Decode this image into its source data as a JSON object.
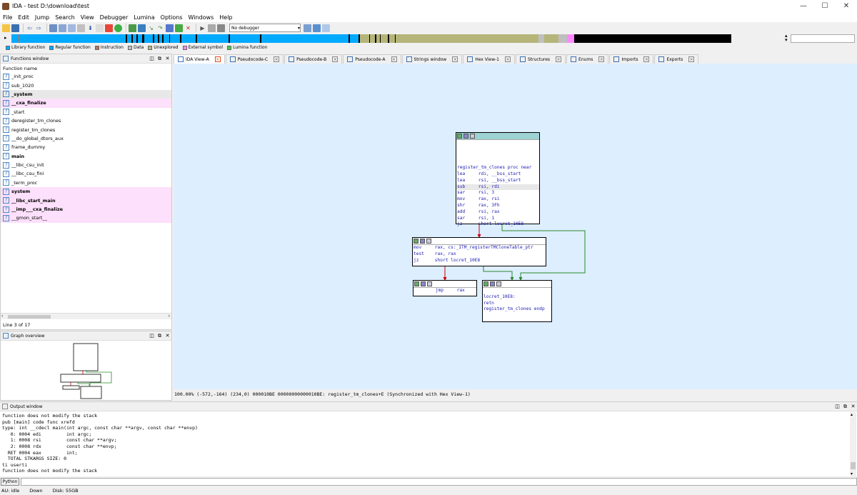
{
  "window": {
    "title": "IDA - test D:\\download\\test",
    "minimize": "—",
    "maximize": "☐",
    "close": "✕"
  },
  "menu": [
    "File",
    "Edit",
    "Jump",
    "Search",
    "View",
    "Debugger",
    "Lumina",
    "Options",
    "Windows",
    "Help"
  ],
  "toolbar": {
    "debugger": "No debugger"
  },
  "legend": [
    {
      "label": "Library function",
      "color": "#00aaff"
    },
    {
      "label": "Regular function",
      "color": "#00aaff"
    },
    {
      "label": "Instruction",
      "color": "#b5725a"
    },
    {
      "label": "Data",
      "color": "#bfbfbf"
    },
    {
      "label": "Unexplored",
      "color": "#b5b57a"
    },
    {
      "label": "External symbol",
      "color": "#ff88ff"
    },
    {
      "label": "Lumina function",
      "color": "#44cc44"
    }
  ],
  "functions_window": {
    "title": "Functions window",
    "column": "Function name",
    "status": "Line 3 of 17",
    "items": [
      {
        "name": "_init_proc",
        "style": ""
      },
      {
        "name": "sub_1020",
        "style": ""
      },
      {
        "name": "_system",
        "style": "grey bold"
      },
      {
        "name": "__cxa_finalize",
        "style": "pink bold"
      },
      {
        "name": "_start",
        "style": ""
      },
      {
        "name": "deregister_tm_clones",
        "style": ""
      },
      {
        "name": "register_tm_clones",
        "style": ""
      },
      {
        "name": "__do_global_dtors_aux",
        "style": ""
      },
      {
        "name": "frame_dummy",
        "style": ""
      },
      {
        "name": "main",
        "style": "bold"
      },
      {
        "name": "__libc_csu_init",
        "style": ""
      },
      {
        "name": "__libc_csu_fini",
        "style": ""
      },
      {
        "name": "_term_proc",
        "style": ""
      },
      {
        "name": "system",
        "style": "pink bold"
      },
      {
        "name": "__libc_start_main",
        "style": "pink bold"
      },
      {
        "name": "__imp___cxa_finalize",
        "style": "pink bold"
      },
      {
        "name": "__gmon_start__",
        "style": "pink"
      }
    ]
  },
  "graph_overview": {
    "title": "Graph overview"
  },
  "tabs": [
    "IDA View-A",
    "Pseudocode-C",
    "Pseudocode-B",
    "Pseudocode-A",
    "Strings window",
    "Hex View-1",
    "Structures",
    "Enums",
    "Imports",
    "Exports"
  ],
  "nodes": {
    "n1": [
      "",
      "",
      "",
      "",
      "register_tm_clones proc near",
      "lea     rdi, __bss_start",
      "lea     rsi, __bss_start",
      "sub     rsi, rdi",
      "sar     rsi, 3",
      "mov     rax, rsi",
      "shr     rax, 3Fh",
      "add     rsi, rax",
      "sar     rsi, 1",
      "jz      short locret_10E8"
    ],
    "n2": [
      "mov     rax, cs:_ITM_registerTMCloneTable_ptr",
      "test    rax, rax",
      "jz      short locret_10E8"
    ],
    "n3": [
      "        jmp     rax"
    ],
    "n4": [
      "",
      "locret_10E8:",
      "retn",
      "register_tm_clones endp"
    ]
  },
  "graph_status": "100.00% (-572,-164) (234,0) 000010BE 00000000000010BE: register_tm_clones+E (Synchronized with Hex View-1)",
  "output": {
    "title": "Output window",
    "lines": "function does not modify the stack\npub [main] code func xrefd\ntype: int __cdecl main(int argc, const char **argv, const char **envp)\n   0: 0004 edi         int argc;\n   1: 0008 rsi         const char **argv;\n   2: 0008 rdx         const char **envp;\n  RET 0004 eax         int;\n  TOTAL STKARGS SIZE: 0\nti userti\nfunction does not modify the stack"
  },
  "python": {
    "label": "Python"
  },
  "status": {
    "au": "AU:  idle",
    "dir": "Down",
    "disk": "Disk: 55GB"
  }
}
